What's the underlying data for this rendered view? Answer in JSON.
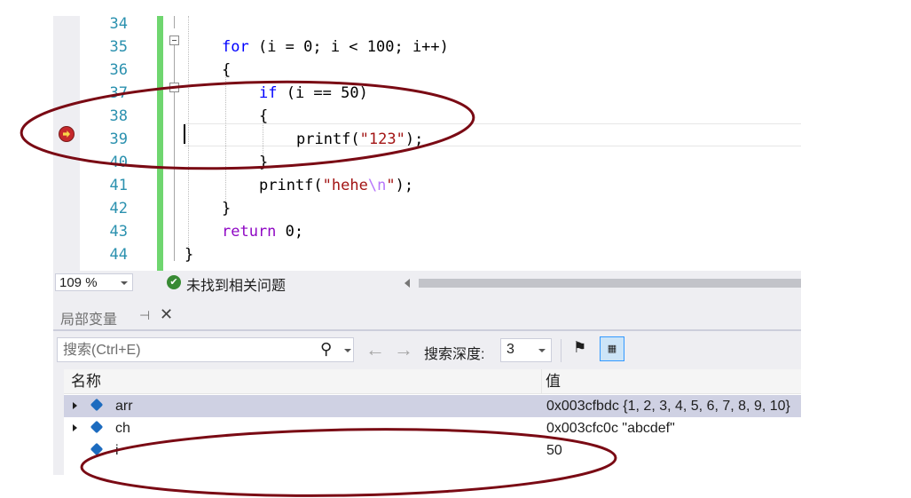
{
  "editor": {
    "lines": [
      {
        "num": "34",
        "tokens": []
      },
      {
        "num": "35",
        "tokens": [
          {
            "t": "for",
            "c": "kw"
          },
          {
            "t": " (i = 0; i < 100; i++)",
            "c": ""
          }
        ]
      },
      {
        "num": "36",
        "tokens": [
          {
            "t": "{",
            "c": ""
          }
        ]
      },
      {
        "num": "37",
        "tokens": [
          {
            "t": "if",
            "c": "kw"
          },
          {
            "t": " (i == 50)",
            "c": ""
          }
        ]
      },
      {
        "num": "38",
        "tokens": [
          {
            "t": "{",
            "c": ""
          }
        ]
      },
      {
        "num": "39",
        "tokens": [
          {
            "t": "printf(",
            "c": ""
          },
          {
            "t": "\"123\"",
            "c": "str"
          },
          {
            "t": ");",
            "c": ""
          }
        ]
      },
      {
        "num": "40",
        "tokens": [
          {
            "t": "}",
            "c": ""
          }
        ]
      },
      {
        "num": "41",
        "tokens": [
          {
            "t": "printf(",
            "c": ""
          },
          {
            "t": "\"hehe",
            "c": "str"
          },
          {
            "t": "\\n",
            "c": "esc"
          },
          {
            "t": "\"",
            "c": "str"
          },
          {
            "t": ");",
            "c": ""
          }
        ]
      },
      {
        "num": "42",
        "tokens": [
          {
            "t": "}",
            "c": ""
          }
        ]
      },
      {
        "num": "43",
        "tokens": [
          {
            "t": "return",
            "c": "kw2"
          },
          {
            "t": " 0;",
            "c": ""
          }
        ]
      },
      {
        "num": "44",
        "tokens": [
          {
            "t": "}",
            "c": ""
          }
        ]
      }
    ]
  },
  "status": {
    "zoom": "109 %",
    "issues": "未找到相关问题"
  },
  "locals": {
    "tab_title": "局部变量",
    "pin_glyph": "⊣",
    "close_glyph": "✕",
    "search_placeholder": "搜索(Ctrl+E)",
    "depth_label": "搜索深度:",
    "depth_value": "3",
    "col_name": "名称",
    "col_value": "值",
    "rows": [
      {
        "name": "arr",
        "value": "0x003cfbdc {1, 2, 3, 4, 5, 6, 7, 8, 9, 10}"
      },
      {
        "name": "ch",
        "value": "0x003cfc0c \"abcdef\""
      },
      {
        "name": "i",
        "value": "50"
      }
    ]
  },
  "colors": {
    "annotation": "#7a0a14",
    "change_bar": "#6fd66f",
    "keyword": "#0000ff"
  }
}
